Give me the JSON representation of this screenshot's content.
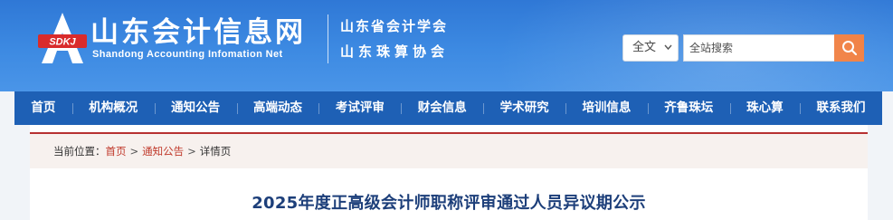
{
  "header": {
    "logo_badge": "SDKJ",
    "logo_letter": "A",
    "site_title": "山东会计信息网",
    "site_subtitle": "Shandong Accounting Infomation Net",
    "org_line1": "山东省会计学会",
    "org_line2": "山东珠算协会"
  },
  "search": {
    "scope_selected": "全文",
    "placeholder": "全站搜索",
    "button_icon": "search-icon"
  },
  "nav": {
    "items": [
      "首页",
      "机构概况",
      "通知公告",
      "高端动态",
      "考试评审",
      "财会信息",
      "学术研究",
      "培训信息",
      "齐鲁珠坛",
      "珠心算",
      "联系我们"
    ]
  },
  "breadcrumb": {
    "prefix": "当前位置：",
    "items": [
      "首页",
      "通知公告",
      "详情页"
    ],
    "separator": ">"
  },
  "article": {
    "title": "2025年度正高级会计师职称评审通过人员异议期公示"
  },
  "colors": {
    "header_blue": "#2f78d6",
    "nav_blue": "#1e60b5",
    "search_orange": "#f07a3a",
    "breadcrumb_red": "#b73131",
    "title_navy": "#1d3f7a"
  }
}
